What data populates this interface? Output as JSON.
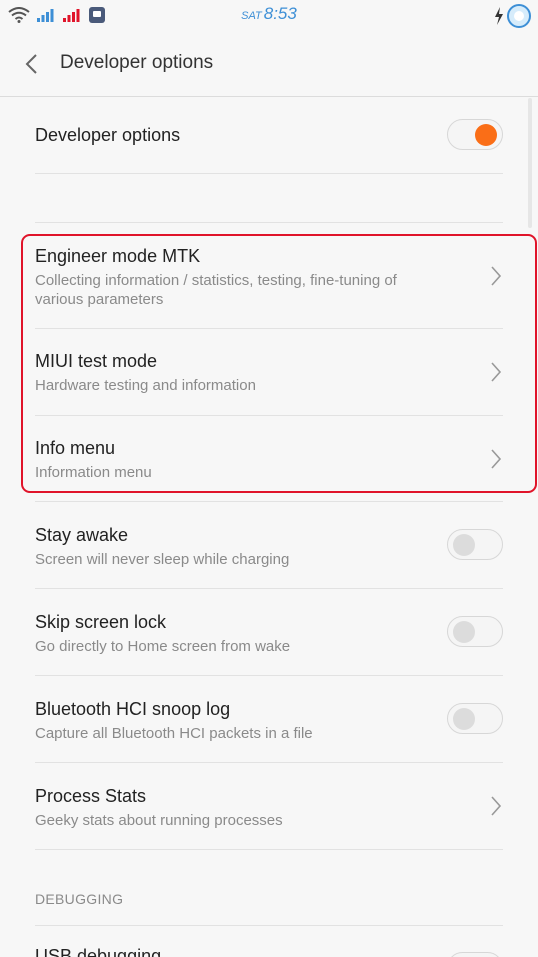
{
  "status_bar": {
    "day": "SAT",
    "time": "8:53",
    "icons_left": [
      "wifi-icon",
      "signal-icon",
      "signal-icon",
      "app-notification-icon"
    ],
    "icons_right": [
      "charging-icon",
      "battery-icon"
    ],
    "time_color": "#3d8fd6",
    "signal_colors": [
      "#3d8fd6",
      "#e0142a"
    ]
  },
  "header": {
    "title": "Developer options",
    "back_icon": "chevron-left-icon"
  },
  "master_toggle": {
    "label": "Developer options",
    "enabled": true,
    "accent": "#fa6e17"
  },
  "highlight_color": "#e0142a",
  "items": [
    {
      "title": "Engineer mode MTK",
      "subtitle": "Collecting information / statistics, testing, fine-tuning of",
      "subtitle2": "various parameters",
      "control": "chevron"
    },
    {
      "title": "MIUI test mode",
      "subtitle": "Hardware testing and information",
      "control": "chevron"
    },
    {
      "title": "Info menu",
      "subtitle": "Information menu",
      "control": "chevron"
    },
    {
      "title": "Stay awake",
      "subtitle": "Screen will never sleep while charging",
      "control": "toggle",
      "enabled": false
    },
    {
      "title": "Skip screen lock",
      "subtitle": "Go directly to Home screen from wake",
      "control": "toggle",
      "enabled": false
    },
    {
      "title": "Bluetooth HCI snoop log",
      "subtitle": "Capture all Bluetooth HCI packets in a file",
      "control": "toggle",
      "enabled": false
    },
    {
      "title": "Process Stats",
      "subtitle": "Geeky stats about running processes",
      "control": "chevron"
    }
  ],
  "section": {
    "label": "DEBUGGING"
  },
  "next_item": {
    "title": "USB debugging"
  }
}
